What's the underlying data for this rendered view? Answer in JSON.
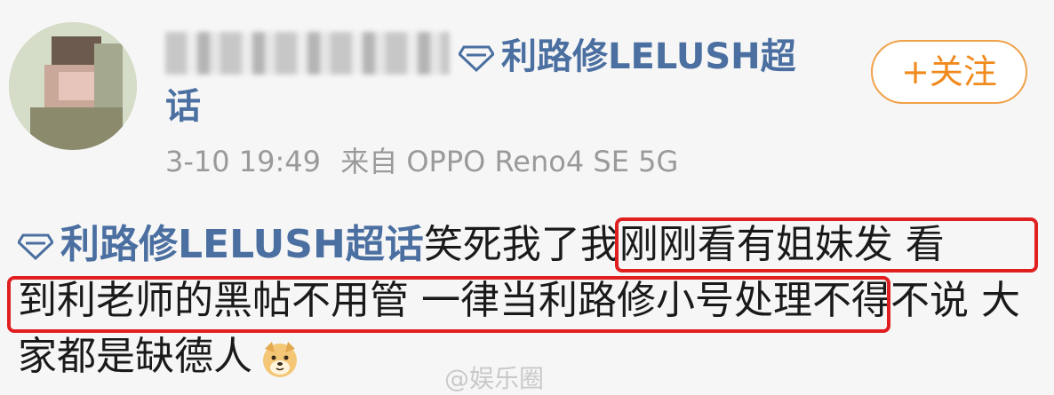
{
  "header": {
    "super_topic_line1": "利路修LELUSH超",
    "super_topic_line2": "话",
    "follow_label": "+关注"
  },
  "meta": {
    "timestamp": "3-10 19:49",
    "source": "来自 OPPO Reno4 SE 5G"
  },
  "post": {
    "topic_tag": "利路修LELUSH超话",
    "text_before": "笑死我了",
    "text_highlight_1a": "我刚刚看有姐妹发 看",
    "text_highlight_1b": "到利老师的黑帖不用管 一律当利路修小号处理",
    "text_after": "不得不说 大家都是缺德人"
  },
  "colors": {
    "link": "#4a6fa0",
    "follow": "#f08a1d",
    "highlight_box": "#e02020"
  },
  "watermark": "@娱乐圈"
}
